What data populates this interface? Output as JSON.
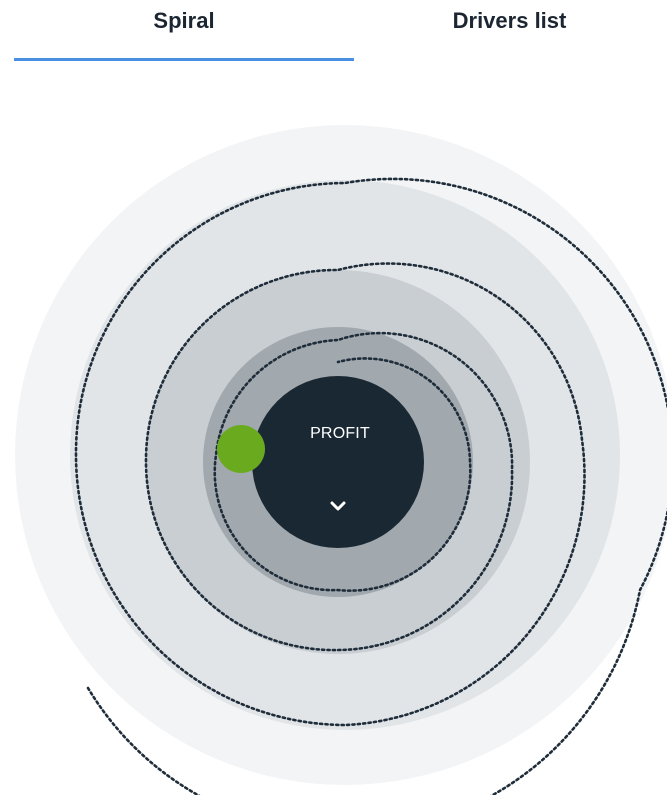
{
  "tabs": [
    {
      "label": "Spiral",
      "active": true
    },
    {
      "label": "Drivers list",
      "active": false
    }
  ],
  "diagram": {
    "center_label": "PROFIT",
    "expand_icon": "chevron-down-icon",
    "marker_color": "#6aaa1e",
    "core_color": "#1a2833",
    "active_tab_color": "#4a90e2"
  }
}
